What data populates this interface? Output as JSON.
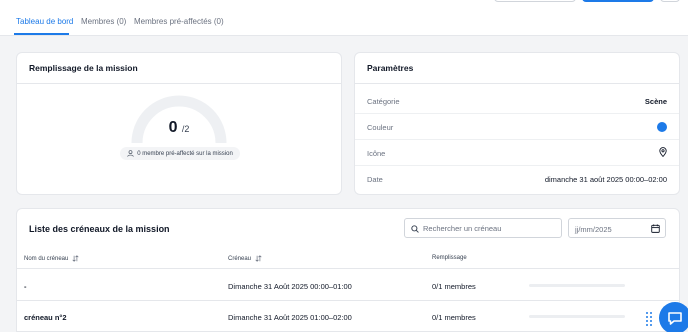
{
  "tabs": [
    {
      "label": "Tableau de bord",
      "active": true
    },
    {
      "label": "Membres (0)",
      "active": false
    },
    {
      "label": "Membres pré-affectés (0)",
      "active": false
    }
  ],
  "fill_card": {
    "title": "Remplissage de la mission",
    "filled": "0",
    "total_label": "/2",
    "fill_fraction": 0,
    "preassigned_label": "0 membre pré-affecté sur la mission"
  },
  "params_card": {
    "title": "Paramètres",
    "rows": [
      {
        "label": "Catégorie",
        "value": "Scène"
      },
      {
        "label": "Couleur",
        "color": "#1d7ae8"
      },
      {
        "label": "Icône",
        "icon": "map-pin-icon"
      },
      {
        "label": "Date",
        "value": "dimanche 31 août 2025 00:00–02:00"
      }
    ]
  },
  "slots_card": {
    "title": "Liste des créneaux de la mission",
    "search_placeholder": "Rechercher un créneau",
    "date_placeholder": "jj/mm/2025",
    "columns": [
      "Nom du créneau",
      "Créneau",
      "Remplissage"
    ],
    "rows": [
      {
        "name": "-",
        "slot": "Dimanche 31 Août 2025 00:00–01:00",
        "fill": "0/1 membres",
        "fill_fraction": 0
      },
      {
        "name": "créneau n°2",
        "slot": "Dimanche 31 Août 2025 01:00–02:00",
        "fill": "0/1 membres",
        "fill_fraction": 0
      }
    ]
  },
  "colors": {
    "accent": "#1d7ae8",
    "gauge_track": "#eef0f3"
  }
}
